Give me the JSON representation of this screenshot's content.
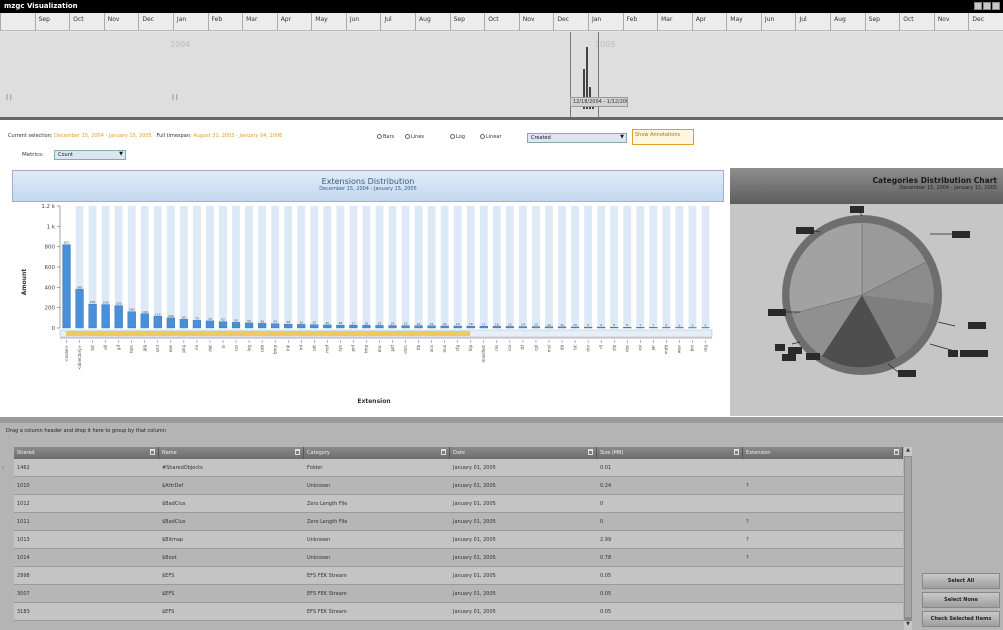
{
  "window": {
    "title": "mzgc Visualization"
  },
  "timeline": {
    "months": [
      "",
      "Sep",
      "Oct",
      "Nov",
      "Dec",
      "Jan",
      "Feb",
      "Mar",
      "Apr",
      "May",
      "Jun",
      "Jul",
      "Aug",
      "Sep",
      "Oct",
      "Nov",
      "Dec",
      "Jan",
      "Feb",
      "Mar",
      "Apr",
      "May",
      "Jun",
      "Jul",
      "Aug",
      "Sep",
      "Oct",
      "Nov",
      "Dec"
    ],
    "year_a": "2004",
    "year_b": "2005",
    "range_label": "12/18/2004 - 1/12/2005",
    "left_mark": "| |",
    "mid_mark": "| |"
  },
  "toolbar": {
    "current_selection_label": "Current selection:",
    "current_selection_value": "December 15, 2004 - January 15, 2005",
    "full_timespan_label": "Full timespan:",
    "full_timespan_value": "August 31, 2003 - January 04, 2006",
    "radio_bars": "Bars",
    "radio_lines": "Lines",
    "radio_log": "Log",
    "radio_linear": "Linear",
    "date_field_value": "Created",
    "show_annotations": "Show Annotations",
    "metrics_label": "Metrics:",
    "metrics_value": "Count"
  },
  "extensions_chart": {
    "title": "Extensions Distribution",
    "subtitle": "December 15, 2004 - January 15, 2005",
    "xlabel": "Extension",
    "ylabel": "Amount"
  },
  "chart_data": {
    "type": "bar",
    "ylim": [
      0,
      1200
    ],
    "yticks": [
      "0",
      "200",
      "400",
      "600",
      "800",
      "1 k",
      "1.2 k"
    ],
    "values": [
      820,
      380,
      235,
      230,
      220,
      160,
      140,
      115,
      100,
      85,
      75,
      70,
      62,
      55,
      50,
      46,
      42,
      38,
      35,
      32,
      30,
      28,
      27,
      26,
      25,
      24,
      23,
      22,
      21,
      20,
      19,
      18,
      17,
      16,
      15,
      14,
      13,
      12,
      11,
      10,
      9,
      9,
      8,
      8,
      7,
      7,
      6,
      6,
      5,
      5
    ],
    "categories": [
      "<none>",
      "<directory>",
      "txt",
      "dll",
      "gif",
      "htm",
      "jpg",
      "xml",
      "exe",
      "png",
      "ini",
      "dat",
      "js",
      "css",
      "log",
      "cab",
      "bmp",
      "lnk",
      "inf",
      "cat",
      "mof",
      "sys",
      "pnf",
      "tmp",
      "doc",
      "pdf",
      "chm",
      "tlb",
      "ocx",
      "mui",
      "cfg",
      "hlp",
      "manifest",
      "nls",
      "ico",
      "ttf",
      "cpl",
      "msi",
      "db",
      "lst",
      "drv",
      "rll",
      "zip",
      "vbs",
      "xsl",
      "jar",
      "mdb",
      "wav",
      "bin",
      "reg"
    ]
  },
  "categories_chart": {
    "title": "Categories Distribution Chart",
    "subtitle": "December 15, 2004 - January 15, 2005"
  },
  "grid": {
    "group_hint": "Drag a column header and drop it here to group by that column",
    "columns": [
      "Shared",
      "Name",
      "Category",
      "Date",
      "Size (MB)",
      "Extension"
    ],
    "rows": [
      [
        "1462",
        "#SharedObjects",
        "Folder",
        "January 01, 2005",
        "0.01",
        ""
      ],
      [
        "1010",
        "$AttrDef",
        "Unknown",
        "January 01, 2005",
        "0.24",
        "?"
      ],
      [
        "1012",
        "$BadClus",
        "Zero Length File",
        "January 01, 2005",
        "0",
        ""
      ],
      [
        "1011",
        "$BadClus",
        "Zero Length File",
        "January 01, 2005",
        "0",
        "?"
      ],
      [
        "1013",
        "$Bitmap",
        "Unknown",
        "January 01, 2005",
        "2.99",
        "?"
      ],
      [
        "1014",
        "$Boot",
        "Unknown",
        "January 01, 2005",
        "0.78",
        "?"
      ],
      [
        "2998",
        "$EFS",
        "EFS FEK Stream",
        "January 01, 2005",
        "0.05",
        ""
      ],
      [
        "3007",
        "$EFS",
        "EFS FEK Stream",
        "January 01, 2005",
        "0.05",
        ""
      ],
      [
        "3183",
        "$EFS",
        "EFS FEK Stream",
        "January 01, 2005",
        "0.05",
        ""
      ]
    ]
  },
  "buttons": {
    "select_all": "Select All",
    "select_none": "Select None",
    "check_selected": "Check Selected Items"
  }
}
